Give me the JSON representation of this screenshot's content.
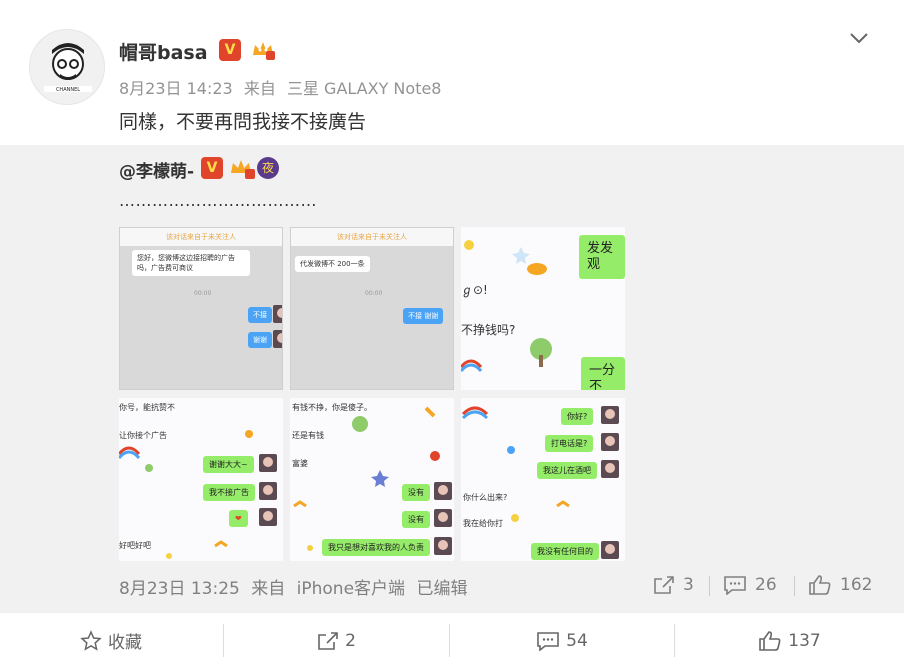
{
  "post": {
    "username": "帽哥basa",
    "verified_badge": "V",
    "meta": {
      "time": "8月23日 14:23",
      "source_prefix": "来自",
      "source": "三星 GALAXY Note8"
    },
    "text": "同樣，不要再問我接不接廣告"
  },
  "repost": {
    "username": "@李檬萌-",
    "verified_badge": "V",
    "night_badge": "夜",
    "text": "………………………………",
    "images": {
      "img1": {
        "topbar": "该对话来自于未关注人",
        "msg1": "您好，您微博这边接招聘的广告吗，广告费可商议",
        "time": "00:00",
        "reply1": "不接",
        "reply2": "谢谢"
      },
      "img2": {
        "topbar": "该对话来自于未关注人",
        "msg1": "代发微博不 200一条",
        "time": "00:00",
        "reply1": "不接 谢谢"
      },
      "img3": {
        "bubble1": "发发观",
        "text1": "ℊ⊙!",
        "text2": "不挣钱吗?",
        "bubble2": "一分不"
      },
      "img4": {
        "text1": "你号，能抗赞不",
        "text2": "让你接个广告",
        "b1": "谢谢大大~",
        "b2": "我不接广告",
        "b3": "❤",
        "text3": "好吧好吧"
      },
      "img5": {
        "text1": "有钱不挣，你是傻子。",
        "text2": "还是有钱",
        "text3": "富婆",
        "b1": "没有",
        "b2": "没有",
        "b3": "我只是想对喜欢我的人负责"
      },
      "img6": {
        "b1": "你好?",
        "b2": "打电话是?",
        "b3": "我这儿在酒吧",
        "text1": "你什么出来?",
        "text2": "我在给你打",
        "b4": "我没有任何目的"
      }
    },
    "footer": {
      "time": "8月23日 13:25",
      "source_prefix": "来自",
      "source": "iPhone客户端",
      "edited": "已编辑",
      "reposts": "3",
      "comments": "26",
      "likes": "162"
    }
  },
  "actions": {
    "favorite_label": "收藏",
    "repost_count": "2",
    "comment_count": "54",
    "like_count": "137"
  },
  "colors": {
    "accent_red": "#e0452b",
    "wechat_green": "#95ec69",
    "chat_blue": "#4aa3f4",
    "repost_bg": "#f1f1f2"
  }
}
